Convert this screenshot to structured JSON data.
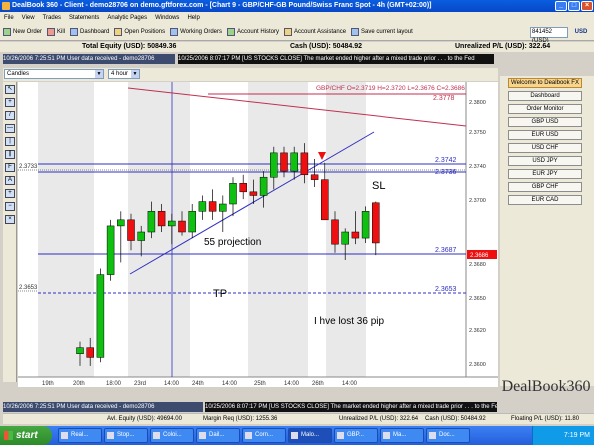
{
  "window": {
    "title": "DealBook 360 - Client - demo28706 on demo.gftforex.com - [Chart 9 - GBP/CHF-GB Pound/Swiss Franc Spot - 4h (GMT+02:00)]"
  },
  "menu": [
    "File",
    "View",
    "Trades",
    "Statements",
    "Analytic Pages",
    "Windows",
    "Help"
  ],
  "toolbar": {
    "buttons": [
      "New Order",
      "Kill",
      "Dashboard",
      "Open Positions",
      "Working Orders",
      "Account History",
      "Account Assistance",
      "Save current layout"
    ],
    "account": "841452 (USD)",
    "currency": "USD"
  },
  "totals": {
    "total_equity": "Total Equity (USD): 50849.36",
    "cash": "Cash (USD): 50484.92",
    "unrealized": "Unrealized P/L (USD): 322.64"
  },
  "tickers": {
    "top_left": "10/26/2006 7:25:51 PM User data received - demo28706",
    "top_right": "10/25/2006 8:07:17 PM [US STOCKS CLOSE] The market ended higher after a mixed trade prior . . . to the Fed",
    "bottom_left": "10/26/2006 7:25:51 PM User data received - demo28706",
    "bottom_right": "10/25/2006 8:07:17 PM [US STOCKS CLOSE] The market ended higher after a mixed trade prior . . . to the Fed"
  },
  "chart_toolbar": {
    "style": "Candles",
    "timeframe": "4 hour"
  },
  "chart": {
    "ohlc_header": "GBP/CHF O=2.3719 H=2.3720 L=2.3676 C=2.3686",
    "current_price": "2.3686",
    "levels": [
      "2.3778",
      "2.3742",
      "2.3736",
      "2.3733",
      "2.3687",
      "2.3653",
      "2.3653"
    ],
    "price_ticks": [
      "2.3800",
      "2.3750",
      "2.3740",
      "2.3700",
      "2.3680",
      "2.3650",
      "2.3620",
      "2.3600"
    ],
    "time_ticks": [
      "19th",
      "20th",
      "18:00",
      "23rd",
      "14:00",
      "24th",
      "14:00",
      "25th",
      "14:00",
      "26th",
      "14:00"
    ],
    "annotations": {
      "sl": "SL",
      "projection": "55 projection",
      "tp": "TP",
      "loss": "I hve lost 36 pip"
    },
    "colors": {
      "up": "#10c010",
      "down": "#ee1010",
      "level": "#3030c0",
      "channel": "#c03050"
    }
  },
  "chart_data": {
    "type": "candlestick",
    "title": "GBP/CHF O=2.3719 H=2.3720 L=2.3676 C=2.3686",
    "x_ticks": [
      "19th",
      "20th",
      "18:00",
      "23rd",
      "14:00",
      "24th",
      "14:00",
      "25th",
      "14:00",
      "26th",
      "14:00"
    ],
    "y_ticks": [
      "2.3800",
      "2.3750",
      "2.3740",
      "2.3700",
      "2.3680",
      "2.3650",
      "2.3620",
      "2.3600"
    ],
    "ylim": [
      2.358,
      2.381
    ],
    "candles": [
      {
        "o": 2.3595,
        "h": 2.3605,
        "l": 2.3585,
        "c": 2.36
      },
      {
        "o": 2.36,
        "h": 2.3608,
        "l": 2.3585,
        "c": 2.3592
      },
      {
        "o": 2.3592,
        "h": 2.3665,
        "l": 2.3588,
        "c": 2.366
      },
      {
        "o": 2.366,
        "h": 2.3705,
        "l": 2.3655,
        "c": 2.37
      },
      {
        "o": 2.37,
        "h": 2.3712,
        "l": 2.367,
        "c": 2.3705
      },
      {
        "o": 2.3705,
        "h": 2.371,
        "l": 2.368,
        "c": 2.3688
      },
      {
        "o": 2.3688,
        "h": 2.37,
        "l": 2.3675,
        "c": 2.3695
      },
      {
        "o": 2.3695,
        "h": 2.372,
        "l": 2.369,
        "c": 2.3712
      },
      {
        "o": 2.3712,
        "h": 2.3718,
        "l": 2.3695,
        "c": 2.37
      },
      {
        "o": 2.37,
        "h": 2.371,
        "l": 2.3685,
        "c": 2.3704
      },
      {
        "o": 2.3704,
        "h": 2.3712,
        "l": 2.3692,
        "c": 2.3695
      },
      {
        "o": 2.3695,
        "h": 2.3718,
        "l": 2.369,
        "c": 2.3712
      },
      {
        "o": 2.3712,
        "h": 2.3725,
        "l": 2.3705,
        "c": 2.372
      },
      {
        "o": 2.372,
        "h": 2.373,
        "l": 2.3705,
        "c": 2.3712
      },
      {
        "o": 2.3712,
        "h": 2.3725,
        "l": 2.3695,
        "c": 2.3718
      },
      {
        "o": 2.3718,
        "h": 2.374,
        "l": 2.3708,
        "c": 2.3735
      },
      {
        "o": 2.3735,
        "h": 2.3742,
        "l": 2.3722,
        "c": 2.3728
      },
      {
        "o": 2.3728,
        "h": 2.3738,
        "l": 2.3718,
        "c": 2.3725
      },
      {
        "o": 2.3725,
        "h": 2.3745,
        "l": 2.3715,
        "c": 2.374
      },
      {
        "o": 2.374,
        "h": 2.3765,
        "l": 2.373,
        "c": 2.376
      },
      {
        "o": 2.376,
        "h": 2.3765,
        "l": 2.374,
        "c": 2.3745
      },
      {
        "o": 2.3745,
        "h": 2.3765,
        "l": 2.3738,
        "c": 2.376
      },
      {
        "o": 2.376,
        "h": 2.3768,
        "l": 2.3735,
        "c": 2.3742
      },
      {
        "o": 2.3742,
        "h": 2.3755,
        "l": 2.3732,
        "c": 2.3738
      },
      {
        "o": 2.3738,
        "h": 2.3752,
        "l": 2.372,
        "c": 2.3705
      },
      {
        "o": 2.3705,
        "h": 2.3712,
        "l": 2.3678,
        "c": 2.3685
      },
      {
        "o": 2.3685,
        "h": 2.3698,
        "l": 2.3672,
        "c": 2.3695
      },
      {
        "o": 2.3695,
        "h": 2.3712,
        "l": 2.3685,
        "c": 2.369
      },
      {
        "o": 2.369,
        "h": 2.3716,
        "l": 2.3686,
        "c": 2.3712
      },
      {
        "o": 2.3719,
        "h": 2.372,
        "l": 2.3676,
        "c": 2.3686
      }
    ]
  },
  "right_panel": {
    "items": [
      "Welcome to Dealbook FX",
      "Dashboard",
      "Order Monitor",
      "GBP USD",
      "EUR USD",
      "USD CHF",
      "USD JPY",
      "EUR JPY",
      "GBP CHF",
      "EUR CAD"
    ]
  },
  "logo": "DealBook360",
  "statusbar": {
    "avail_equity": "Avl. Equity (USD): 49694.00",
    "margin_req": "Margin Req (USD): 1255.36",
    "unrealized": "Unrealized P/L (USD): 322.64",
    "cash": "Cash (USD): 50484.92",
    "floating": "Floating P/L (USD): 11.80"
  },
  "taskbar": {
    "start": "start",
    "tasks": [
      "Real...",
      "Stop...",
      "Coloi...",
      "Dail...",
      "Corn...",
      "Malo...",
      "GBP...",
      "Ma...",
      "Doc..."
    ],
    "time": "7:19 PM"
  }
}
